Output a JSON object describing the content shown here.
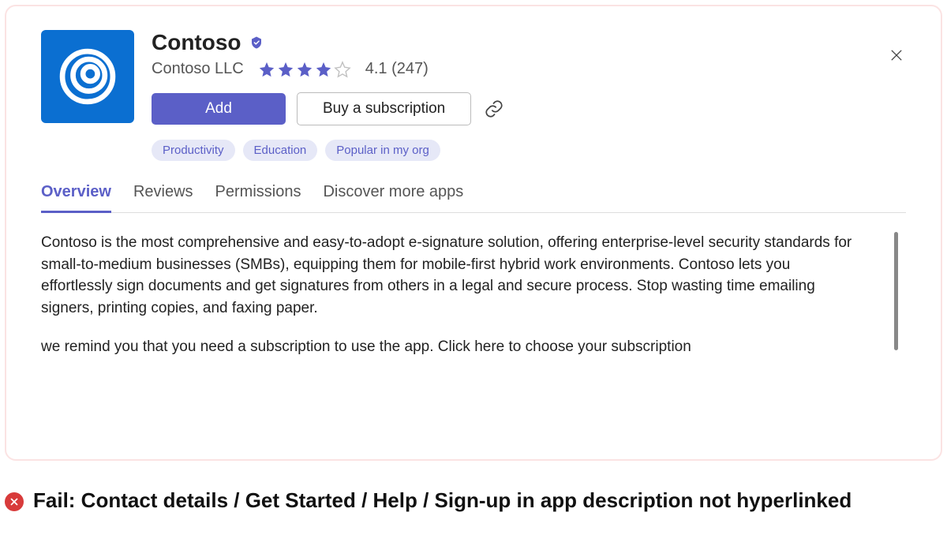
{
  "header": {
    "title": "Contoso",
    "publisher": "Contoso LLC",
    "rating_value": "4.1",
    "rating_count": "247",
    "rating_text": "4.1 (247)",
    "stars_full": 4,
    "stars_total": 5
  },
  "actions": {
    "add_label": "Add",
    "buy_label": "Buy a subscription"
  },
  "tags": [
    "Productivity",
    "Education",
    "Popular in my org"
  ],
  "tabs": [
    {
      "label": "Overview",
      "active": true
    },
    {
      "label": "Reviews",
      "active": false
    },
    {
      "label": "Permissions",
      "active": false
    },
    {
      "label": "Discover more apps",
      "active": false
    }
  ],
  "description": {
    "p1": "Contoso is the most comprehensive and easy-to-adopt e-signature solution, offering enterprise-level security standards for small-to-medium businesses (SMBs), equipping them for mobile-first hybrid work environments. Contoso lets you effortlessly sign documents and get signatures from others in a legal and secure process. Stop wasting time emailing signers, printing copies, and faxing paper.",
    "p2": "we remind you that  you need a subscription to use the app. Click here to choose your subscription"
  },
  "fail_banner": {
    "text": "Fail: Contact details / Get Started / Help / Sign-up in app description not hyperlinked"
  },
  "colors": {
    "primary": "#5b5fc7",
    "icon_bg": "#0b6fd1",
    "error": "#d83b3b"
  }
}
